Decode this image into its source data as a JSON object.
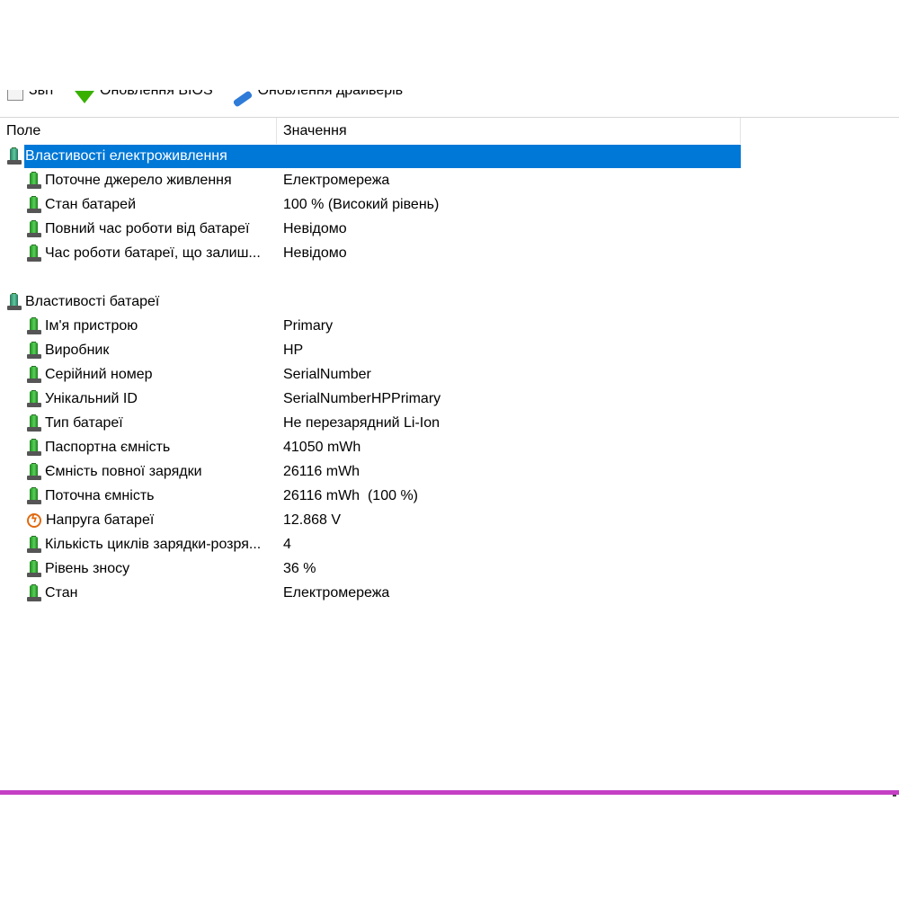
{
  "toolbar": {
    "items": [
      {
        "label": "Звіт",
        "icon": "report-icon"
      },
      {
        "label": "Оновлення BIOS",
        "icon": "bios-update-icon"
      },
      {
        "label": "Оновлення драйверів",
        "icon": "driver-update-icon"
      }
    ]
  },
  "columns": {
    "field": "Поле",
    "value": "Значення"
  },
  "groups": {
    "power": {
      "title": "Властивості електроживлення",
      "rows": [
        {
          "field": "Поточне джерело живлення",
          "value": "Електромережа"
        },
        {
          "field": "Стан батарей",
          "value": "100 % (Високий рівень)"
        },
        {
          "field": "Повний час роботи від батареї",
          "value": "Невідомо"
        },
        {
          "field": "Час роботи батареї, що залиш...",
          "value": "Невідомо"
        }
      ]
    },
    "battery": {
      "title": "Властивості батареї",
      "rows": [
        {
          "field": "Ім'я пристрою",
          "value": "Primary"
        },
        {
          "field": "Виробник",
          "value": "HP"
        },
        {
          "field": "Серійний номер",
          "value": "SerialNumber"
        },
        {
          "field": "Унікальний ID",
          "value": "SerialNumberHPPrimary"
        },
        {
          "field": "Тип батареї",
          "value": "Не перезарядний Li-Ion"
        },
        {
          "field": "Паспортна ємність",
          "value": "41050 mWh"
        },
        {
          "field": "Ємність повної зарядки",
          "value": "26116 mWh"
        },
        {
          "field": "Поточна ємність",
          "value": "26116 mWh  (100 %)"
        },
        {
          "field": "Напруга батареї",
          "value": "12.868 V"
        },
        {
          "field": "Кількість циклів зарядки-розря...",
          "value": "4"
        },
        {
          "field": "Рівень зносу",
          "value": "36 %"
        },
        {
          "field": "Стан",
          "value": "Електромережа"
        }
      ]
    }
  },
  "colors": {
    "selection": "#0078d7",
    "bottom_bar": "#c43fc4"
  }
}
